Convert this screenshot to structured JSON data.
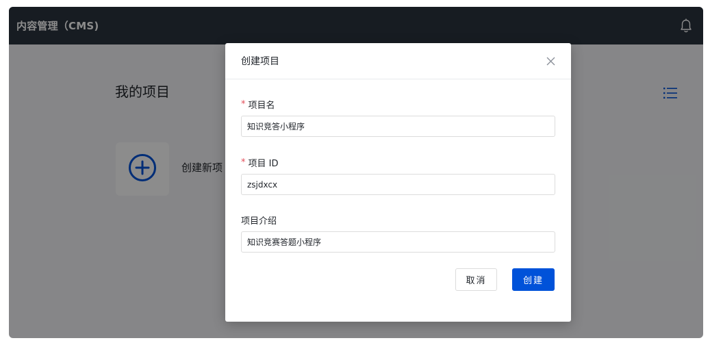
{
  "header": {
    "title": "内容管理（CMS)",
    "bell_icon": "bell-icon"
  },
  "main": {
    "page_title": "我的项目",
    "view_toggle_icon": "list-icon",
    "create_card": {
      "icon": "plus-circle-icon",
      "label": "创建新项"
    }
  },
  "modal": {
    "title": "创建项目",
    "close_icon": "close-icon",
    "fields": [
      {
        "label": "项目名",
        "required": true,
        "value": "知识竞答小程序"
      },
      {
        "label": "项目 ID",
        "required": true,
        "value": "zsjdxcx"
      },
      {
        "label": "项目介绍",
        "required": false,
        "value": "知识竞赛答题小程序"
      }
    ],
    "required_mark": "*",
    "cancel_label": "取消",
    "submit_label": "创建"
  },
  "colors": {
    "topbar": "#2b333f",
    "primary": "#0052d9",
    "required": "#e34d59"
  }
}
